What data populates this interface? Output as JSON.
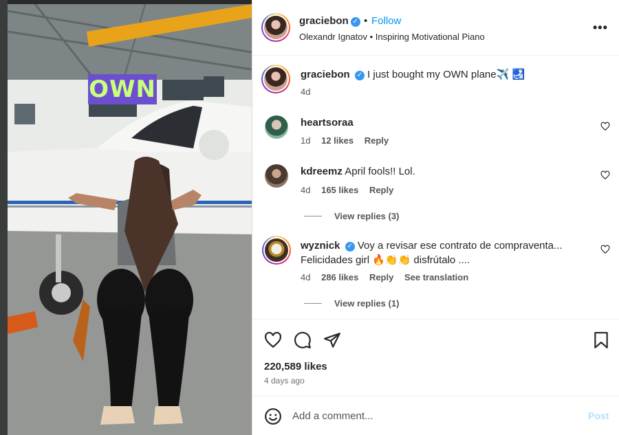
{
  "media": {
    "overlay_text": "OWN"
  },
  "header": {
    "username": "graciebon",
    "verified_mark": "✓",
    "separator": "•",
    "follow_label": "Follow",
    "audio": "Olexandr Ignatov • Inspiring Motivational Piano",
    "more_icon": "more-options-icon"
  },
  "caption": {
    "username": "graciebon",
    "verified_mark": "✓",
    "text": "I just bought my OWN plane✈️ 🛃",
    "time": "4d"
  },
  "comments": [
    {
      "username": "heartsoraa",
      "text": "",
      "time": "1d",
      "likes": "12 likes",
      "reply_label": "Reply"
    },
    {
      "username": "kdreemz",
      "text": "April fools!! Lol.",
      "time": "4d",
      "likes": "165 likes",
      "reply_label": "Reply",
      "view_replies": "View replies (3)"
    },
    {
      "username": "wyznick",
      "verified_mark": "✓",
      "text_line1": "Voy a revisar ese contrato de compraventa...",
      "text_line2": "Felicidades girl 🔥👏👏 disfrútalo ....",
      "time": "4d",
      "likes": "286 likes",
      "reply_label": "Reply",
      "translation_label": "See translation",
      "view_replies": "View replies (1)"
    }
  ],
  "actions": {
    "icons": [
      "heart-icon",
      "comment-icon",
      "share-icon",
      "bookmark-icon"
    ],
    "likes": "220,589 likes",
    "posted": "4 days ago"
  },
  "add_comment": {
    "placeholder": "Add a comment...",
    "post_label": "Post"
  },
  "colors": {
    "link_blue": "#0095f6",
    "verified_blue": "#3897f0",
    "post_disabled": "#b2dffc",
    "overlay_bg": "#6b4fd0",
    "overlay_text": "#c9ff7a"
  }
}
